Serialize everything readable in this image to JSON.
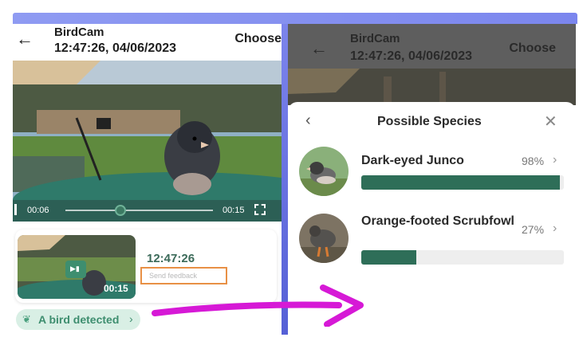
{
  "left_screen": {
    "app_title": "BirdCam",
    "datetime": "12:47:26, 04/06/2023",
    "choose_label": "Choose",
    "video": {
      "current_time": "00:06",
      "duration": "00:15"
    },
    "event": {
      "time": "12:47:26",
      "feedback_label": "Send feedback",
      "thumb_duration": "00:15"
    },
    "detected_label": "A bird detected"
  },
  "right_screen": {
    "app_title": "BirdCam",
    "datetime": "12:47:26, 04/06/2023",
    "choose_label": "Choose",
    "sheet_title": "Possible Species",
    "species": [
      {
        "name": "Dark-eyed Junco",
        "confidence_label": "98%",
        "confidence": 98
      },
      {
        "name": "Orange-footed Scrubfowl",
        "confidence_label": "27%",
        "confidence": 27
      }
    ]
  },
  "colors": {
    "accent_green": "#3e8e6f",
    "bar_fill": "#2e6e58",
    "highlight_orange": "#e89045",
    "arrow_magenta": "#d619d6",
    "divider_blue": "#6b74e4"
  },
  "icons": [
    "back-arrow-icon",
    "close-icon",
    "chevron-right-icon",
    "leaf-icon",
    "fullscreen-icon",
    "play-icon"
  ]
}
